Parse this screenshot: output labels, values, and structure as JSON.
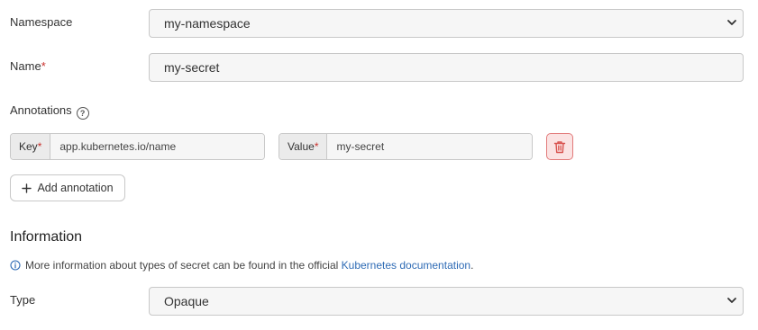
{
  "namespace": {
    "label": "Namespace",
    "value": "my-namespace"
  },
  "name": {
    "label": "Name",
    "required_marker": "*",
    "value": "my-secret"
  },
  "annotations": {
    "label": "Annotations",
    "help_glyph": "?",
    "rows": [
      {
        "key_label": "Key",
        "key_value": "app.kubernetes.io/name",
        "value_label": "Value",
        "value_value": "my-secret"
      }
    ],
    "add_button_label": "Add annotation"
  },
  "information": {
    "title": "Information",
    "text_before": "More information about types of secret can be found in the official ",
    "link_text": "Kubernetes documentation",
    "text_after": "."
  },
  "type": {
    "label": "Type",
    "value": "Opaque"
  },
  "colors": {
    "required": "#c9302c",
    "link": "#2e6bb5",
    "danger": "#d9534f"
  },
  "icons": [
    "chevron-down-icon",
    "help-icon",
    "trash-icon",
    "plus-icon",
    "info-icon"
  ]
}
